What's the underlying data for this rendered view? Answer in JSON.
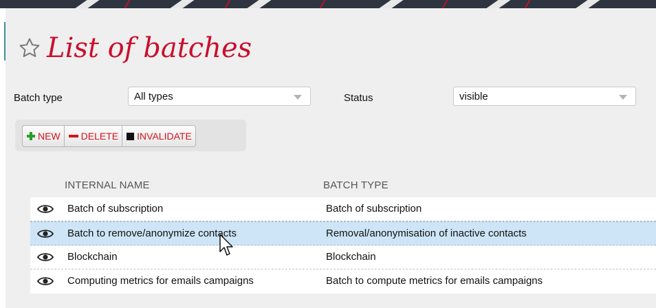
{
  "page": {
    "title": "List of batches",
    "favorite_icon": "star-outline-icon",
    "accent_color": "#c8102e"
  },
  "filters": {
    "batch_type_label": "Batch type",
    "batch_type_value": "All types",
    "status_label": "Status",
    "status_value": "visible"
  },
  "toolbar": {
    "new_label": "NEW",
    "delete_label": "DELETE",
    "invalidate_label": "INVALIDATE"
  },
  "table": {
    "columns": [
      "INTERNAL NAME",
      "BATCH TYPE"
    ],
    "rows": [
      {
        "internal_name": "Batch of subscription",
        "batch_type": "Batch of subscription",
        "selected": false
      },
      {
        "internal_name": "Batch to remove/anonymize contacts",
        "batch_type": "Removal/anonymisation of inactive contacts",
        "selected": true
      },
      {
        "internal_name": "Blockchain",
        "batch_type": "Blockchain",
        "selected": false
      },
      {
        "internal_name": "Computing metrics for emails campaigns",
        "batch_type": "Batch to compute metrics for emails campaigns",
        "selected": false
      }
    ],
    "row_icon": "eye-icon"
  }
}
